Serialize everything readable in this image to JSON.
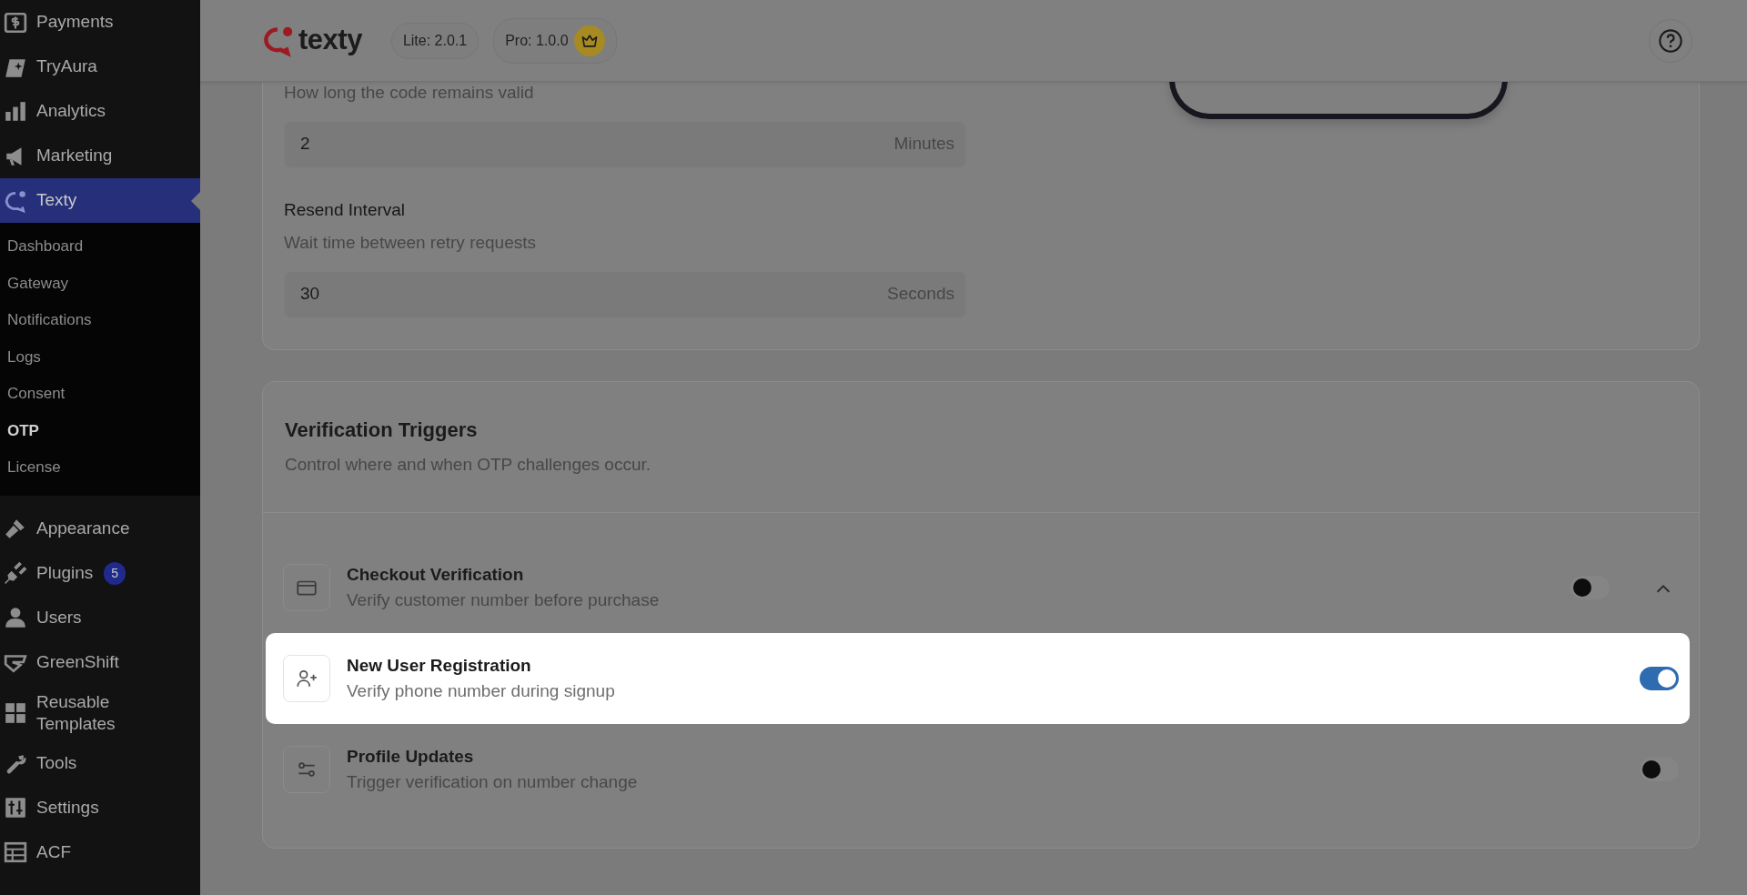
{
  "sidebar": {
    "items": [
      {
        "label": "Payments",
        "selected": false
      },
      {
        "label": "TryAura",
        "selected": false
      },
      {
        "label": "Analytics",
        "selected": false
      },
      {
        "label": "Marketing",
        "selected": false
      },
      {
        "label": "Texty",
        "selected": true,
        "children": [
          {
            "label": "Dashboard",
            "selected": false
          },
          {
            "label": "Gateway",
            "selected": false
          },
          {
            "label": "Notifications",
            "selected": false
          },
          {
            "label": "Logs",
            "selected": false
          },
          {
            "label": "Consent",
            "selected": false
          },
          {
            "label": "OTP",
            "selected": true
          },
          {
            "label": "License",
            "selected": false
          }
        ]
      },
      {
        "label": "Appearance",
        "selected": false
      },
      {
        "label": "Plugins",
        "selected": false,
        "badge": "5"
      },
      {
        "label": "Users",
        "selected": false
      },
      {
        "label": "GreenShift",
        "selected": false
      },
      {
        "label": "Reusable Templates",
        "selected": false
      },
      {
        "label": "Tools",
        "selected": false
      },
      {
        "label": "Settings",
        "selected": false
      },
      {
        "label": "ACF",
        "selected": false
      }
    ]
  },
  "header": {
    "logo": "texty",
    "versions": [
      {
        "label": "Lite: 2.0.1",
        "pro": false
      },
      {
        "label": "Pro: 1.0.0",
        "pro": true
      }
    ]
  },
  "code_settings": {
    "fields": [
      {
        "description": "How long the code remains valid",
        "value": "2",
        "unit": "Minutes"
      },
      {
        "label": "Resend Interval",
        "description": "Wait time between retry requests",
        "value": "30",
        "unit": "Seconds"
      }
    ]
  },
  "triggers": {
    "title": "Verification Triggers",
    "description": "Control where and when OTP challenges occur.",
    "items": [
      {
        "kind": "expandable",
        "title": "Checkout Verification",
        "description": "Verify customer number before purchase",
        "on": false,
        "highlighted": false
      },
      {
        "kind": "plain",
        "title": "New User Registration",
        "description": "Verify phone number during signup",
        "on": true,
        "highlighted": true
      },
      {
        "kind": "plain",
        "title": "Profile Updates",
        "description": "Trigger verification on number change",
        "on": false,
        "highlighted": false
      }
    ]
  }
}
